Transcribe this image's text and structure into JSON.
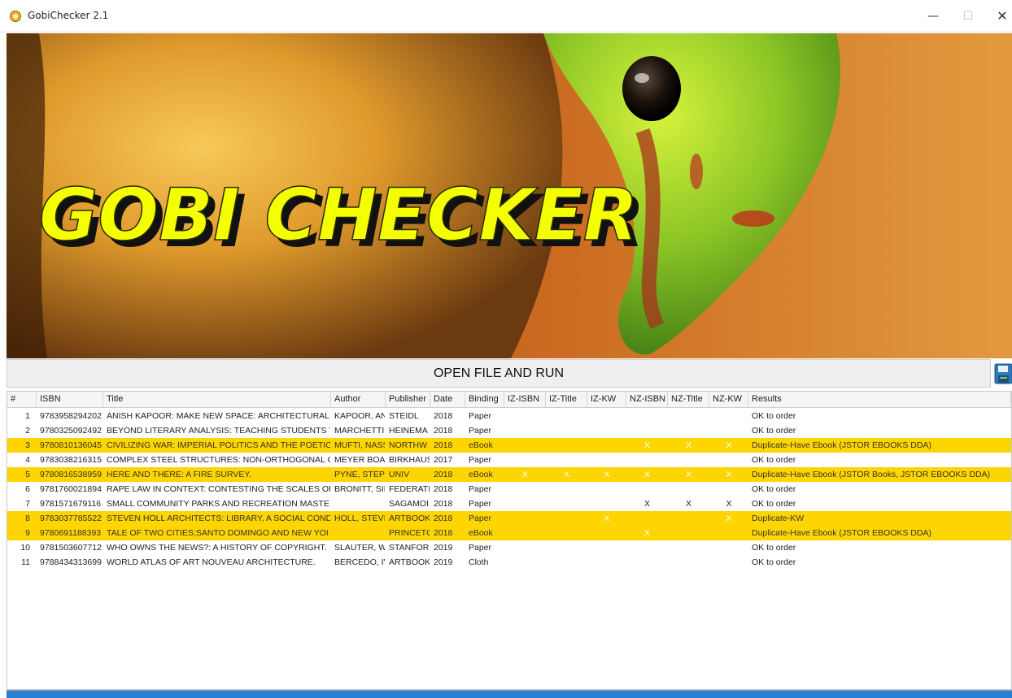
{
  "window": {
    "title": "GobiChecker 2.1",
    "minimize_glyph": "—",
    "maximize_glyph": "☐",
    "close_glyph": "✕"
  },
  "banner": {
    "logo_text": "GOBI CHECKER"
  },
  "run_button": {
    "label": "OPEN FILE AND RUN"
  },
  "save_icon": "floppy-disk-icon",
  "highlight_color": "#ffd500",
  "table": {
    "headers": [
      "#",
      "ISBN",
      "Title",
      "Author",
      "Publisher",
      "Date",
      "Binding",
      "IZ-ISBN",
      "IZ-Title",
      "IZ-KW",
      "NZ-ISBN",
      "NZ-Title",
      "NZ-KW",
      "Results"
    ],
    "rows": [
      {
        "num": "1",
        "isbn": "9783958294202",
        "title": "ANISH KAPOOR: MAKE NEW SPACE: ARCHITECTURAL",
        "author": "KAPOOR, AN",
        "publisher": "STEIDL",
        "date": "2018",
        "binding": "Paper",
        "iz_isbn": "",
        "iz_title": "",
        "iz_kw": "",
        "nz_isbn": "",
        "nz_title": "",
        "nz_kw": "",
        "results": "OK to order",
        "highlight": false
      },
      {
        "num": "2",
        "isbn": "9780325092492",
        "title": "BEYOND LITERARY ANALYSIS: TEACHING STUDENTS T(",
        "author": "MARCHETTI,",
        "publisher": "HEINEMA",
        "date": "2018",
        "binding": "Paper",
        "iz_isbn": "",
        "iz_title": "",
        "iz_kw": "",
        "nz_isbn": "",
        "nz_title": "",
        "nz_kw": "",
        "results": "OK to order",
        "highlight": false
      },
      {
        "num": "3",
        "isbn": "9780810136045",
        "title": "CIVILIZING WAR: IMPERIAL POLITICS AND THE POETIC",
        "author": "MUFTI, NASS",
        "publisher": "NORTHW",
        "date": "2018",
        "binding": "eBook",
        "iz_isbn": "",
        "iz_title": "",
        "iz_kw": "",
        "nz_isbn": "X",
        "nz_title": "X",
        "nz_kw": "X",
        "results": "Duplicate-Have Ebook (JSTOR EBOOKS DDA)",
        "highlight": true
      },
      {
        "num": "4",
        "isbn": "9783038216315",
        "title": "COMPLEX STEEL STRUCTURES: NON-ORTHOGONAL G",
        "author": "MEYER BOAI",
        "publisher": "BIRKHAUS",
        "date": "2017",
        "binding": "Paper",
        "iz_isbn": "",
        "iz_title": "",
        "iz_kw": "",
        "nz_isbn": "",
        "nz_title": "",
        "nz_kw": "",
        "results": "OK to order",
        "highlight": false
      },
      {
        "num": "5",
        "isbn": "9780816538959",
        "title": "HERE AND THERE: A FIRE SURVEY.",
        "author": "PYNE, STEPH",
        "publisher": "UNIV",
        "date": "2018",
        "binding": "eBook",
        "iz_isbn": "X",
        "iz_title": "X",
        "iz_kw": "X",
        "nz_isbn": "X",
        "nz_title": "X",
        "nz_kw": "X",
        "results": "Duplicate-Have Ebook (JSTOR Books, JSTOR EBOOKS DDA)",
        "highlight": true
      },
      {
        "num": "6",
        "isbn": "9781760021894",
        "title": "RAPE LAW IN CONTEXT: CONTESTING THE SCALES OF",
        "author": "BRONITT, SII",
        "publisher": "FEDERATI",
        "date": "2018",
        "binding": "Paper",
        "iz_isbn": "",
        "iz_title": "",
        "iz_kw": "",
        "nz_isbn": "",
        "nz_title": "",
        "nz_kw": "",
        "results": "OK to order",
        "highlight": false
      },
      {
        "num": "7",
        "isbn": "9781571679116",
        "title": "SMALL COMMUNITY PARKS AND RECREATION MASTE",
        "author": "",
        "publisher": "SAGAMOI",
        "date": "2018",
        "binding": "Paper",
        "iz_isbn": "",
        "iz_title": "",
        "iz_kw": "",
        "nz_isbn": "X",
        "nz_title": "X",
        "nz_kw": "X",
        "results": "OK to order",
        "highlight": false
      },
      {
        "num": "8",
        "isbn": "9783037785522",
        "title": "STEVEN HOLL ARCHITECTS: LIBRARY, A SOCIAL COND",
        "author": "HOLL, STEVE",
        "publisher": "ARTBOOK",
        "date": "2018",
        "binding": "Paper",
        "iz_isbn": "",
        "iz_title": "",
        "iz_kw": "X",
        "nz_isbn": "",
        "nz_title": "",
        "nz_kw": "X",
        "results": "Duplicate-KW",
        "highlight": true
      },
      {
        "num": "9",
        "isbn": "9780691188393",
        "title": "TALE OF TWO CITIES;SANTO DOMINGO AND NEW YOI",
        "author": "",
        "publisher": "PRINCETC",
        "date": "2018",
        "binding": "eBook",
        "iz_isbn": "",
        "iz_title": "",
        "iz_kw": "",
        "nz_isbn": "X",
        "nz_title": "",
        "nz_kw": "",
        "results": "Duplicate-Have Ebook (JSTOR EBOOKS DDA)",
        "highlight": true
      },
      {
        "num": "10",
        "isbn": "9781503607712",
        "title": "WHO OWNS THE NEWS?: A HISTORY OF COPYRIGHT.",
        "author": "SLAUTER, WI",
        "publisher": "STANFOR",
        "date": "2019",
        "binding": "Paper",
        "iz_isbn": "",
        "iz_title": "",
        "iz_kw": "",
        "nz_isbn": "",
        "nz_title": "",
        "nz_kw": "",
        "results": "OK to order",
        "highlight": false
      },
      {
        "num": "11",
        "isbn": "9788434313699",
        "title": "WORLD ATLAS OF ART NOUVEAU ARCHITECTURE.",
        "author": "BERCEDO, IV",
        "publisher": "ARTBOOK",
        "date": "2019",
        "binding": "Cloth",
        "iz_isbn": "",
        "iz_title": "",
        "iz_kw": "",
        "nz_isbn": "",
        "nz_title": "",
        "nz_kw": "",
        "results": "OK to order",
        "highlight": false
      }
    ]
  }
}
